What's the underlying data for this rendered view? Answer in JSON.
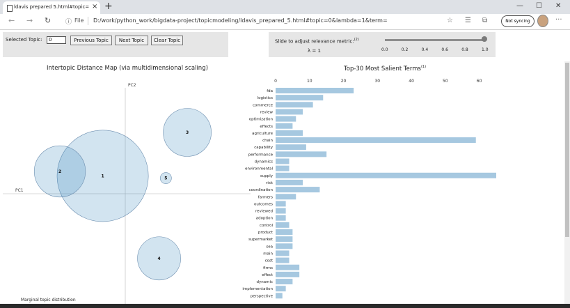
{
  "browser": {
    "tab_title": "ldavis prepared 5.html#topic=0&l",
    "url_scheme_label": "File",
    "url_path": "D:/work/python_work/bigdata-project/topicmodeling/ldavis_prepared_5.html#topic=0&lambda=1&term=",
    "sync_label": "Not syncing"
  },
  "controls": {
    "selected_topic_label": "Selected Topic:",
    "selected_topic_value": "0",
    "prev_button": "Previous Topic",
    "next_button": "Next Topic",
    "clear_button": "Clear Topic",
    "slider_label": "Slide to adjust relevance metric:",
    "slider_superscript": "(2)",
    "lambda_text": "λ = 1",
    "lambda_value": 1,
    "slider_ticks": [
      "0.0",
      "0.2",
      "0.4",
      "0.6",
      "0.8",
      "1.0"
    ]
  },
  "left_panel": {
    "title": "Intertopic Distance Map (via multidimensional scaling)",
    "pc1_label": "PC1",
    "pc2_label": "PC2",
    "marginal_label": "Marginal topic distribution"
  },
  "topic_map": {
    "x_range": [
      -1.0,
      1.0
    ],
    "y_range": [
      -1.0,
      1.0
    ],
    "topics": [
      {
        "label": "1",
        "x": -0.2,
        "y": 0.16,
        "r": 0.57
      },
      {
        "label": "2",
        "x": -0.58,
        "y": 0.2,
        "r": 0.32
      },
      {
        "label": "3",
        "x": 0.55,
        "y": 0.55,
        "r": 0.3
      },
      {
        "label": "4",
        "x": 0.3,
        "y": -0.58,
        "r": 0.27
      },
      {
        "label": "5",
        "x": 0.36,
        "y": 0.14,
        "r": 0.07
      }
    ]
  },
  "right_panel": {
    "title": "Top-30 Most Salient Terms",
    "title_superscript": "(1)"
  },
  "chart_data": {
    "type": "bar",
    "title": "Top-30 Most Salient Terms",
    "orientation": "horizontal",
    "xlim": [
      0,
      65
    ],
    "xticks": [
      "0",
      "10",
      "20",
      "30",
      "40",
      "50",
      "60"
    ],
    "categories": [
      "fda",
      "logistics",
      "commerce",
      "review",
      "optimization",
      "effects",
      "agriculture",
      "chain",
      "capability",
      "performance",
      "dynamics",
      "environmental",
      "supply",
      "risk",
      "coordination",
      "farmers",
      "outcomes",
      "reviewed",
      "adoption",
      "control",
      "product",
      "supermarket",
      "sea",
      "main",
      "cost",
      "firms",
      "effect",
      "dynamic",
      "implementation",
      "perspective"
    ],
    "values": [
      23,
      14,
      11,
      8,
      6,
      5,
      8,
      59,
      9,
      15,
      4,
      4,
      65,
      8,
      13,
      6,
      3,
      3,
      3,
      4,
      5,
      5,
      5,
      4,
      4,
      7,
      7,
      5,
      3,
      2
    ]
  }
}
